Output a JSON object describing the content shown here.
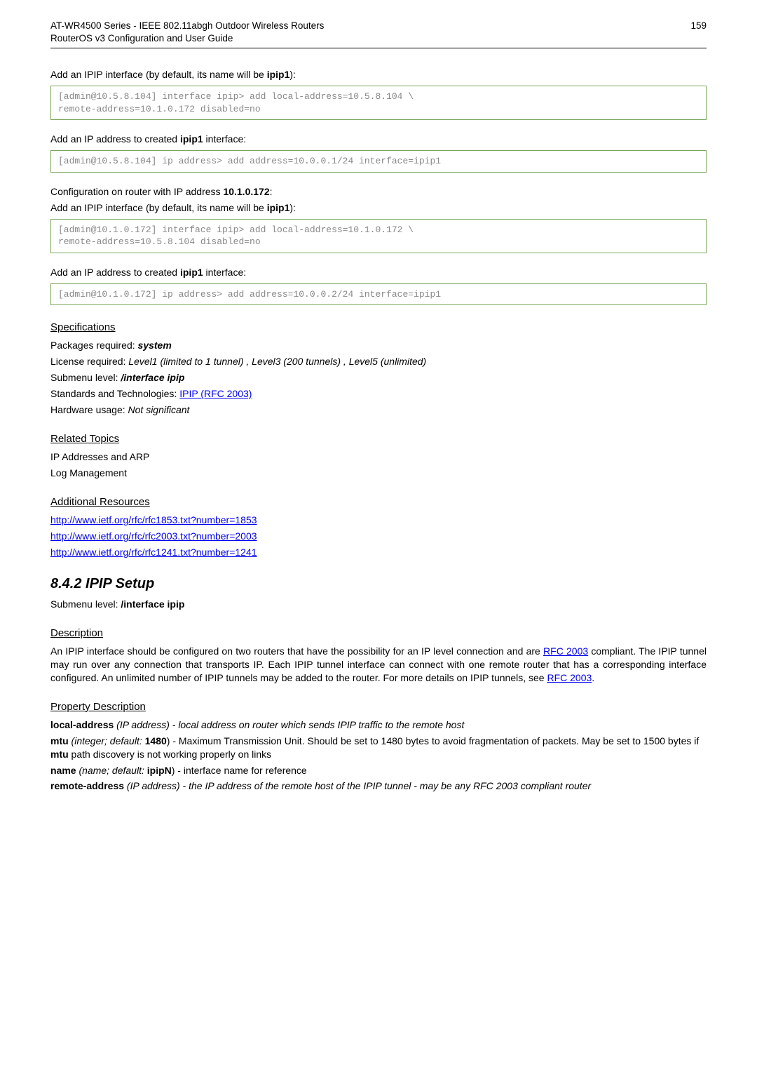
{
  "header": {
    "line1": "AT-WR4500 Series - IEEE 802.11abgh Outdoor Wireless Routers",
    "line2": "RouterOS v3 Configuration and User Guide",
    "page": "159"
  },
  "intro1_prefix": "Add an IPIP interface (by default, its name will be ",
  "intro1_bold": "ipip1",
  "intro1_suffix": "):",
  "code1": "[admin@10.5.8.104] interface ipip> add local-address=10.5.8.104 \\\nremote-address=10.1.0.172 disabled=no",
  "intro2_prefix": "Add an IP address to created ",
  "intro2_bold": "ipip1",
  "intro2_suffix": " interface:",
  "code2": "[admin@10.5.8.104] ip address> add address=10.0.0.1/24 interface=ipip1",
  "conf_prefix": "Configuration on router with IP address ",
  "conf_bold": "10.1.0.172",
  "conf_suffix": ":",
  "intro3_prefix": "Add an IPIP interface (by default, its name will be ",
  "intro3_bold": "ipip1",
  "intro3_suffix": "):",
  "code3": "[admin@10.1.0.172] interface ipip> add local-address=10.1.0.172 \\\nremote-address=10.5.8.104 disabled=no",
  "intro4_prefix": "Add an IP address to created ",
  "intro4_bold": "ipip1",
  "intro4_suffix": " interface:",
  "code4": "[admin@10.1.0.172] ip address> add address=10.0.0.2/24 interface=ipip1",
  "specs": {
    "title": "Specifications",
    "pkg_label": "Packages required: ",
    "pkg_value": "system",
    "lic_label": "License required: ",
    "lic_value": "Level1 (limited to 1 tunnel) , Level3 (200 tunnels) , Level5 (unlimited)",
    "sub_label": "Submenu level: ",
    "sub_value": "/interface ipip",
    "std_label": "Standards and Technologies: ",
    "std_link": "IPIP (RFC 2003)",
    "hw_label": "Hardware usage: ",
    "hw_value": "Not significant"
  },
  "related": {
    "title": "Related Topics",
    "line1": "IP Addresses and ARP",
    "line2": "Log Management"
  },
  "resources": {
    "title": "Additional Resources",
    "link1": "http://www.ietf.org/rfc/rfc1853.txt?number=1853",
    "link2": "http://www.ietf.org/rfc/rfc2003.txt?number=2003",
    "link3": "http://www.ietf.org/rfc/rfc1241.txt?number=1241"
  },
  "setup": {
    "heading": "8.4.2  IPIP Setup",
    "sub_label": "Submenu level: ",
    "sub_value": "/interface ipip"
  },
  "description": {
    "title": "Description",
    "t1": "An IPIP interface should be configured on two routers that have the possibility for an IP level connection and are ",
    "link1": "RFC 2003",
    "t2": " compliant. The IPIP tunnel may run over any connection that transports IP. Each IPIP tunnel interface can connect with one remote router that has a corresponding interface configured. An unlimited number of IPIP tunnels may be added to the router. For more details on IPIP tunnels, see ",
    "link2": "RFC 2003",
    "t3": "."
  },
  "propdesc": {
    "title": "Property Description",
    "la_bold": "local-address",
    "la_rest": " (IP address) - local address on router which sends IPIP traffic to the remote host",
    "mtu_bold": "mtu",
    "mtu_mid1": " (integer; default: ",
    "mtu_default": "1480",
    "mtu_mid2": ") - Maximum Transmission Unit. Should be set to 1480 bytes to avoid fragmentation of packets. May be set to 1500 bytes if ",
    "mtu_bold2": "mtu",
    "mtu_end": " path discovery is not working properly on links",
    "name_bold": "name",
    "name_mid1": " (name; default: ",
    "name_default": "ipipN",
    "name_end": ") - interface name for reference",
    "ra_bold": "remote-address",
    "ra_rest": " (IP address) - the IP address of the remote host of the IPIP tunnel - may be any RFC 2003 compliant router"
  }
}
